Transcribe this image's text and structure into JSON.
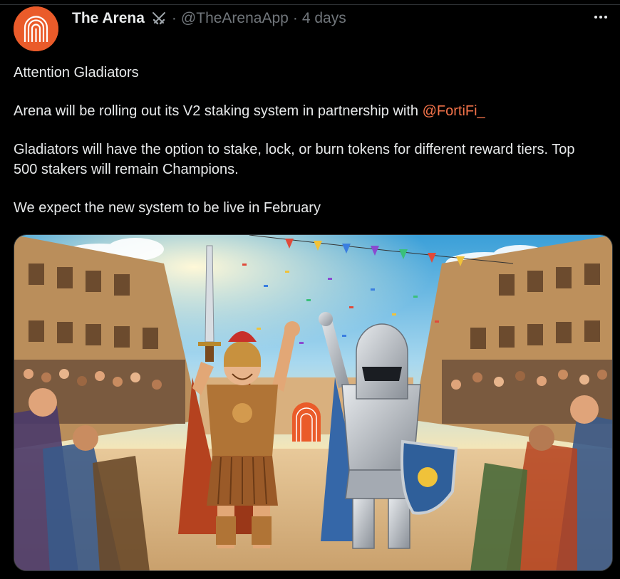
{
  "post": {
    "author": {
      "display_name": "The Arena",
      "handle": "@TheArenaApp",
      "separator": "·",
      "timestamp": "4 days",
      "avatar_color": "#ea5b2a",
      "badge_icon": "crossed-swords-icon"
    },
    "body": {
      "line1": "Attention Gladiators",
      "line2_text": "Arena will be rolling out its V2 staking system in partnership with ",
      "line2_mention": "@FortiFi_",
      "line3": "Gladiators will have the option to stake, lock, or burn tokens for different reward tiers. Top 500 stakers will remain Champions.",
      "line4": "We expect the new system to be live in February"
    },
    "media": {
      "kind": "illustration",
      "icons": [
        "roman-gladiator-with-sword",
        "armored-knight-with-shield",
        "cheering-crowd",
        "colosseum-arena",
        "confetti"
      ]
    },
    "more_icon": "more-options-icon"
  },
  "colors": {
    "background": "#000000",
    "text_primary": "#e7e9ea",
    "text_secondary": "#71767b",
    "mention": "#f4734a",
    "brand_orange": "#ea5b2a"
  }
}
